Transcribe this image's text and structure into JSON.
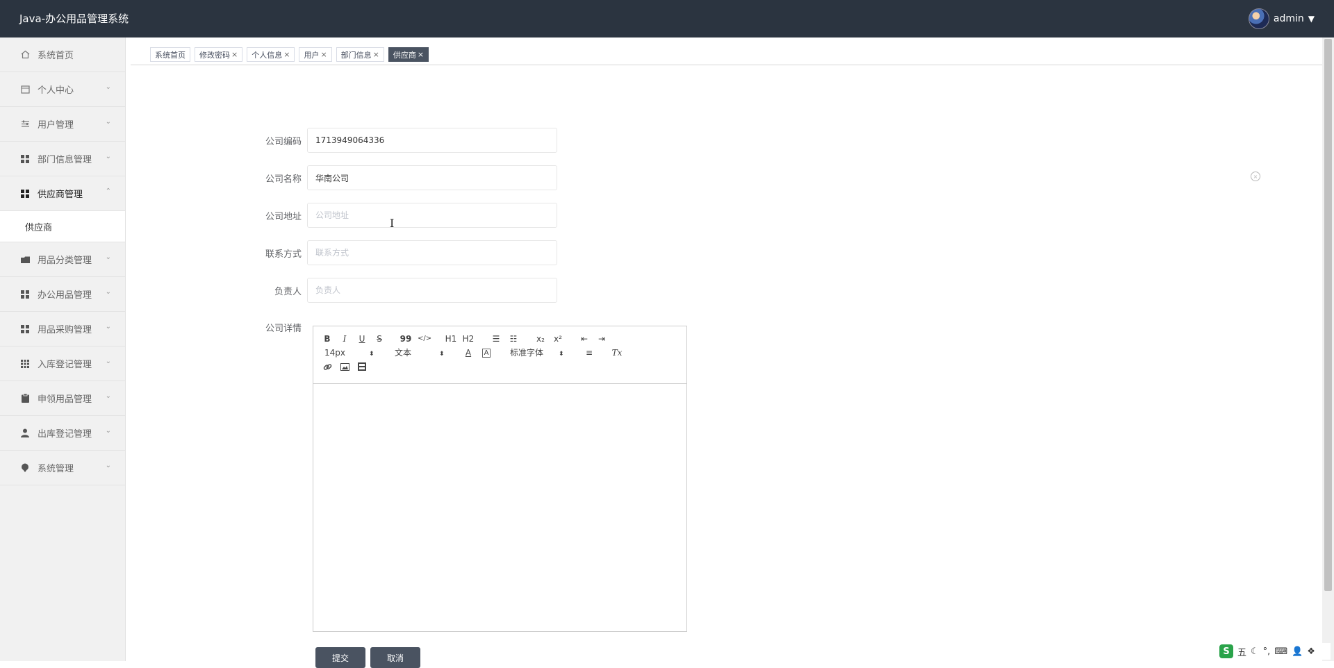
{
  "app": {
    "title": "Java-办公用品管理系统",
    "user": "admin",
    "caret": "▼"
  },
  "sidebar": {
    "items": [
      {
        "label": "系统首页",
        "icon": "home-icon",
        "expandable": false
      },
      {
        "label": "个人中心",
        "icon": "calendar-icon",
        "expandable": true
      },
      {
        "label": "用户管理",
        "icon": "sliders-icon",
        "expandable": true
      },
      {
        "label": "部门信息管理",
        "icon": "grid-icon",
        "expandable": true
      },
      {
        "label": "供应商管理",
        "icon": "grid-icon",
        "expandable": true,
        "expanded": true
      },
      {
        "label": "用品分类管理",
        "icon": "folder-icon",
        "expandable": true
      },
      {
        "label": "办公用品管理",
        "icon": "grid-icon",
        "expandable": true
      },
      {
        "label": "用品采购管理",
        "icon": "grid-icon",
        "expandable": true
      },
      {
        "label": "入库登记管理",
        "icon": "apps-icon",
        "expandable": true
      },
      {
        "label": "申领用品管理",
        "icon": "clipboard-icon",
        "expandable": true
      },
      {
        "label": "出库登记管理",
        "icon": "user-icon",
        "expandable": true
      },
      {
        "label": "系统管理",
        "icon": "pin-icon",
        "expandable": true
      }
    ],
    "sub_item": "供应商"
  },
  "tabs": [
    {
      "label": "系统首页",
      "closable": false,
      "active": false
    },
    {
      "label": "修改密码",
      "closable": true,
      "active": false
    },
    {
      "label": "个人信息",
      "closable": true,
      "active": false
    },
    {
      "label": "用户",
      "closable": true,
      "active": false
    },
    {
      "label": "部门信息",
      "closable": true,
      "active": false
    },
    {
      "label": "供应商",
      "closable": true,
      "active": true
    }
  ],
  "form": {
    "code": {
      "label": "公司编码",
      "value": "1713949064336",
      "placeholder": ""
    },
    "name": {
      "label": "公司名称",
      "value": "华南公司",
      "placeholder": ""
    },
    "address": {
      "label": "公司地址",
      "value": "",
      "placeholder": "公司地址"
    },
    "contact": {
      "label": "联系方式",
      "value": "",
      "placeholder": "联系方式"
    },
    "manager": {
      "label": "负责人",
      "value": "",
      "placeholder": "负责人"
    },
    "detail_label": "公司详情"
  },
  "editor": {
    "bold": "B",
    "italic": "I",
    "underline": "U",
    "strike": "S",
    "quote": "99",
    "code": "</>",
    "h1": "H1",
    "h2": "H2",
    "ordered": "☰",
    "bullet": "☷",
    "sub": "x₂",
    "sup": "x²",
    "outdent": "⇤",
    "indent": "⇥",
    "size": "14px",
    "header": "文本",
    "font": "标准字体",
    "color": "A",
    "background": "A",
    "align": "≡",
    "clean": "Tx",
    "link": "🔗",
    "image": "▣",
    "video": "▤",
    "sel_arrow": "⬍"
  },
  "buttons": {
    "submit": "提交",
    "cancel": "取消"
  },
  "ime": {
    "logo": "S",
    "mode": "五",
    "moon": "☾",
    "punct": "°,",
    "keyboard": "⌨",
    "user": "👤",
    "apps": "❖"
  },
  "colors": {
    "header_bg": "#2b3440",
    "sidebar_bg": "#f1f1f1",
    "accent": "#4a5361"
  }
}
